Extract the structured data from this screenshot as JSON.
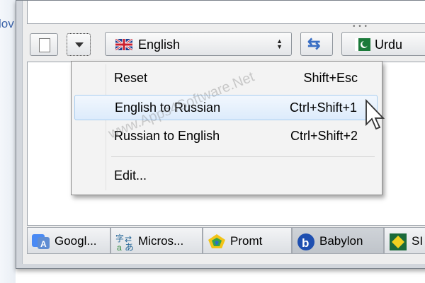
{
  "left_partial_text": "lov",
  "toolbar": {
    "source_language": "English",
    "target_language": "Urdu"
  },
  "menu": {
    "items": [
      {
        "label": "Reset",
        "shortcut": "Shift+Esc"
      },
      {
        "label": "English to Russian",
        "shortcut": "Ctrl+Shift+1"
      },
      {
        "label": "Russian to English",
        "shortcut": "Ctrl+Shift+2"
      }
    ],
    "edit_label": "Edit..."
  },
  "engine_tabs": [
    {
      "label": "Googl...",
      "icon": "google-translate-icon"
    },
    {
      "label": "Micros...",
      "icon": "microsoft-translator-icon"
    },
    {
      "label": "Promt",
      "icon": "promt-icon"
    },
    {
      "label": "Babylon",
      "icon": "babylon-icon",
      "active": true
    },
    {
      "label": "SI",
      "icon": "si-icon"
    }
  ],
  "watermark": "www.Apps4Software.Net",
  "colors": {
    "menu_highlight": "#dcebfc",
    "swap_arrows": "#3a6fc4"
  }
}
